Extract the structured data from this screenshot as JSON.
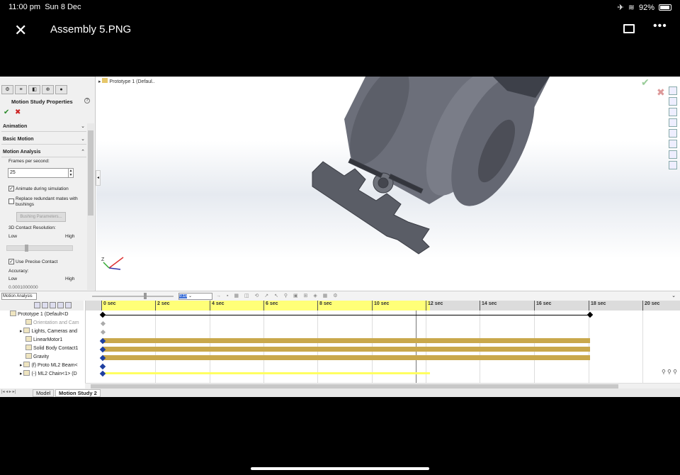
{
  "status_bar": {
    "time": "11:00 pm",
    "date": "Sun 8 Dec",
    "battery": "92%",
    "battery_level": 0.92
  },
  "viewer": {
    "title": "Assembly 5.PNG",
    "close_icon": "close-icon",
    "comment_icon": "comment-icon",
    "more_icon": "more-icon"
  },
  "property_manager": {
    "title": "Motion Study Properties",
    "groups": {
      "animation": "Animation",
      "basic_motion": "Basic Motion",
      "motion_analysis": "Motion Analysis"
    },
    "frames_label": "Frames per second:",
    "frames_value": "25",
    "animate_label": "Animate during simulation",
    "replace_label_1": "Replace redundant mates with",
    "replace_label_2": "bushings",
    "bushing_button": "Bushing Parameters...",
    "contact_resolution_label": "3D Contact Resolution:",
    "low": "Low",
    "high": "High",
    "precise_label": "Use Precise Contact",
    "accuracy_label": "Accuracy:",
    "accuracy_value": "0.0001000000"
  },
  "graphics": {
    "tree_flyout": "Prototype 1  (Defaul..",
    "triad_z": "Z"
  },
  "motion_manager": {
    "study_type": "Motion Analysis",
    "zoom_value": "0.1x",
    "ticks": [
      "0 sec",
      "2 sec",
      "4 sec",
      "6 sec",
      "8 sec",
      "10 sec",
      "12 sec",
      "14 sec",
      "16 sec",
      "18 sec",
      "20 sec"
    ],
    "tree": [
      "Prototype 1  (Default<D",
      "Orientation and Cam",
      "Lights, Cameras and",
      "LinearMotor1",
      "Solid Body Contact1",
      "Gravity",
      "(f) Proto ML2 Beam<",
      "(-) ML2 Chain<1> (D"
    ]
  },
  "tabs": {
    "model": "Model",
    "motion_study": "Motion Study 2"
  }
}
